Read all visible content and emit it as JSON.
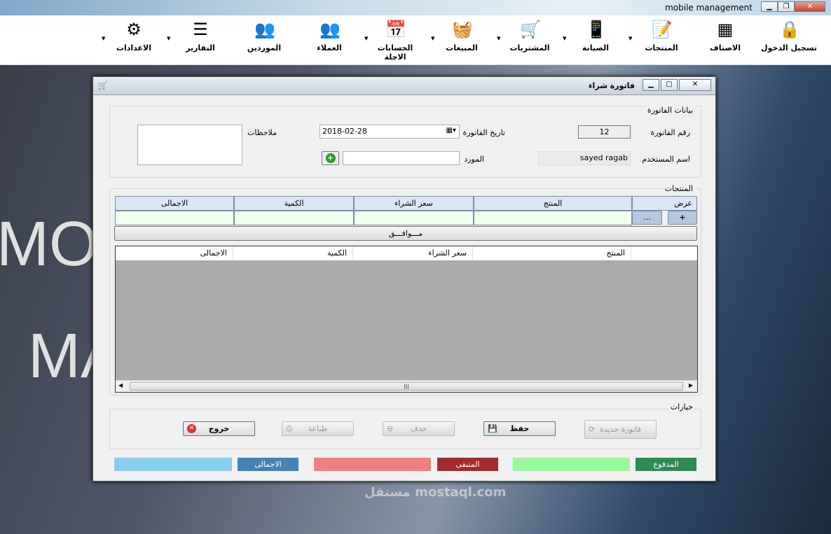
{
  "app": {
    "title": "mobile management"
  },
  "toolbar": [
    {
      "label": "تسجيل الدخول",
      "icon": "lock-icon",
      "glyph": "🔒"
    },
    {
      "label": "الاصناف",
      "icon": "table-icon",
      "glyph": "▦"
    },
    {
      "label": "المنتجات",
      "icon": "edit-document-icon",
      "glyph": "📝"
    },
    {
      "label": "الصيانة",
      "icon": "mobile-phone-icon",
      "glyph": "📱"
    },
    {
      "label": "المشتريات",
      "icon": "shopping-cart-icon",
      "glyph": "🛒"
    },
    {
      "label": "المبيعات",
      "icon": "basket-icon",
      "glyph": "🧺"
    },
    {
      "label": "الحسابات الاجلة",
      "icon": "calendar-icon",
      "glyph": "📅"
    },
    {
      "label": "العملاء",
      "icon": "customers-icon",
      "glyph": "👥"
    },
    {
      "label": "الموردين",
      "icon": "suppliers-icon",
      "glyph": "👥"
    },
    {
      "label": "التقارير",
      "icon": "report-icon",
      "glyph": "☰"
    },
    {
      "label": "الاعدادات",
      "icon": "gear-icon",
      "glyph": "⚙"
    }
  ],
  "background": {
    "line1": "MOB",
    "line2": "MA",
    "watermark": "مستقل mostaql.com"
  },
  "dialog": {
    "title": "فاتورة شراء",
    "invoice_group": "بيانات الفاتورة",
    "invoice_no_label": "رقم الفاتورة",
    "invoice_no": "12",
    "user_label": "اسم المستخدم",
    "user": "sayed ragab",
    "date_label": "تاريخ الفاتورة",
    "date": "2018-02-28",
    "supplier_label": "المورد",
    "supplier": "",
    "notes_label": "ملاحظات",
    "notes": "",
    "products_group": "المنتجات",
    "entry_headers": [
      "الاجمالى",
      "الكمية",
      "سعر الشراء",
      "المنتج",
      "عرض"
    ],
    "add_label": "+",
    "browse_label": "...",
    "ok_label": "مـــوافـــق",
    "grid_headers": [
      "الاجمالى",
      "الكمية",
      "سعر الشراء",
      "المنتج"
    ],
    "options_group": "خيارات",
    "buttons": {
      "exit": "خروج",
      "print": "طباعة",
      "delete": "حذف",
      "save": "حفظ",
      "new": "فاتورة جديدة"
    },
    "totals": {
      "total_label": "الاجمالى",
      "remaining_label": "المتبقى",
      "paid_label": "المدفوع",
      "total": "",
      "remaining": "",
      "paid": ""
    },
    "colors": {
      "total": "#4682b4",
      "total_box": "#87ceeb",
      "remaining": "#a52a2a",
      "remaining_box": "#f08080",
      "paid": "#2e8b57",
      "paid_box": "#98fb98"
    }
  }
}
